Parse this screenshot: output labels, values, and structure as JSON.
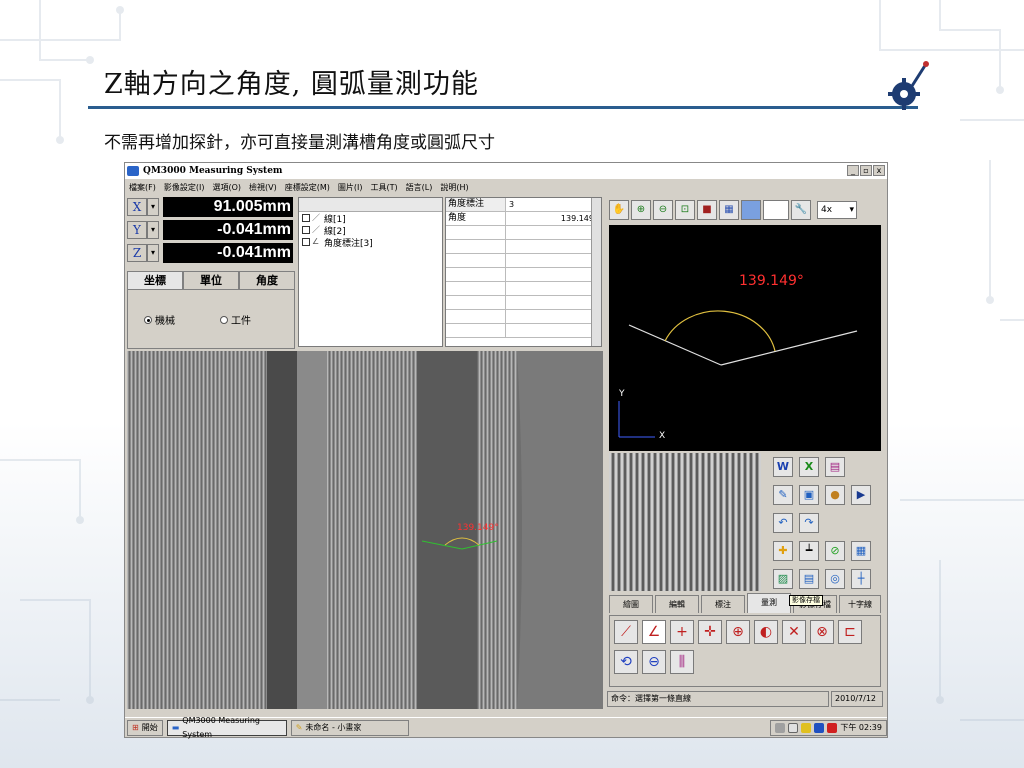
{
  "slide": {
    "title": "Z軸方向之角度, 圓弧量測功能",
    "subtitle": "不需再增加探針，亦可直接量測溝槽角度或圓弧尺寸"
  },
  "window": {
    "title": "QM3000 Measuring System",
    "controls": [
      "_",
      "▫",
      "x"
    ],
    "menu": [
      "檔案(F)",
      "影像設定(I)",
      "選項(O)",
      "檢視(V)",
      "座標設定(M)",
      "圖片(I)",
      "工具(T)",
      "語言(L)",
      "說明(H)"
    ]
  },
  "coordinates": {
    "axes": [
      {
        "label": "X",
        "value": "91.005mm"
      },
      {
        "label": "Y",
        "value": "-0.041mm"
      },
      {
        "label": "Z",
        "value": "-0.041mm"
      }
    ],
    "tabs": [
      "坐標",
      "單位",
      "角度"
    ],
    "radio_machine": "機械",
    "radio_work": "工件"
  },
  "features": {
    "items": [
      "線[1]",
      "線[2]",
      "角度標注[3]"
    ]
  },
  "results": {
    "header": [
      "角度標注",
      "3"
    ],
    "rows": [
      [
        "角度",
        "139.149°"
      ]
    ]
  },
  "toolbar": {
    "zoom": "4x"
  },
  "cad": {
    "angle_label": "139.149°",
    "axis_y": "Y",
    "axis_x": "X"
  },
  "camera": {
    "overlay_label": "139.149°"
  },
  "mode_tabs": [
    "繪圖",
    "編輯",
    "標注",
    "量測",
    "影像存檔",
    "十字線"
  ],
  "tooltip": "影像存檔",
  "status": {
    "command": "命令：選擇第一條直線",
    "date": "2010/7/12"
  },
  "taskbar": {
    "start": "開始",
    "tasks": [
      "QM3000 Measuring System",
      "未命名 - 小畫家"
    ],
    "time": "下午 02:39"
  },
  "colors": {
    "title_line": "#2a5d8f",
    "cad_text": "#ff3030",
    "axis_value_bg": "#000000"
  }
}
